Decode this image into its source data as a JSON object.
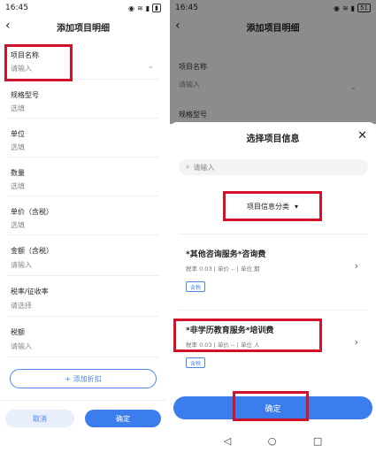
{
  "status": {
    "time": "16:45",
    "right_battery": "51"
  },
  "left": {
    "title": "添加项目明细",
    "fields": [
      {
        "label": "项目名称",
        "value": "请输入"
      },
      {
        "label": "规格型号",
        "value": "选填"
      },
      {
        "label": "单位",
        "value": "选填"
      },
      {
        "label": "数量",
        "value": "选填"
      },
      {
        "label": "单价（含税）",
        "value": "选填"
      },
      {
        "label": "金额（含税）",
        "value": "请输入"
      },
      {
        "label": "税率/征收率",
        "value": "请选择"
      },
      {
        "label": "税额",
        "value": "请输入"
      }
    ],
    "add_discount": "+ 添加折扣",
    "cancel": "取消",
    "confirm": "确定"
  },
  "right": {
    "title": "添加项目明细",
    "dim_fields": [
      {
        "label": "项目名称",
        "value": "请输入"
      },
      {
        "label": "规格型号"
      }
    ],
    "sheet_title": "选择项目信息",
    "search_placeholder": "请输入",
    "category": "项目信息分类",
    "items": [
      {
        "name": "*其他咨询服务*咨询费",
        "meta": "税率 0.03 | 单价 -- | 单位 期",
        "tag": "含税"
      },
      {
        "name": "*非学历教育服务*培训费",
        "meta": "税率 0.03 | 单价 -- | 单位 人",
        "tag": "含税"
      }
    ],
    "confirm": "确定"
  },
  "colors": {
    "accent": "#3b7ded",
    "highlight": "#d1132a"
  }
}
